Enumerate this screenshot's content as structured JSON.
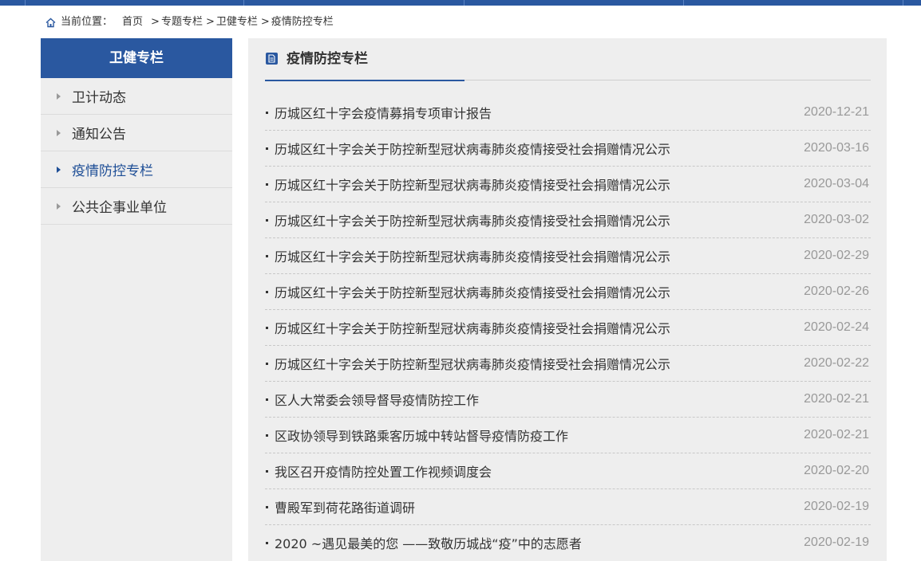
{
  "breadcrumb": {
    "label": "当前位置：",
    "items": [
      "首页",
      "专题专栏",
      "卫健专栏",
      "疫情防控专栏"
    ],
    "separator": ">"
  },
  "sidebar": {
    "title": "卫健专栏",
    "items": [
      {
        "label": "卫计动态",
        "active": false
      },
      {
        "label": "通知公告",
        "active": false
      },
      {
        "label": "疫情防控专栏",
        "active": true
      },
      {
        "label": "公共企事业单位",
        "active": false
      }
    ]
  },
  "main": {
    "title": "疫情防控专栏",
    "icon": "document-icon",
    "news": [
      {
        "title": "历城区红十字会疫情募捐专项审计报告",
        "date": "2020-12-21"
      },
      {
        "title": "历城区红十字会关于防控新型冠状病毒肺炎疫情接受社会捐赠情况公示",
        "date": "2020-03-16"
      },
      {
        "title": "历城区红十字会关于防控新型冠状病毒肺炎疫情接受社会捐赠情况公示",
        "date": "2020-03-04"
      },
      {
        "title": "历城区红十字会关于防控新型冠状病毒肺炎疫情接受社会捐赠情况公示",
        "date": "2020-03-02"
      },
      {
        "title": "历城区红十字会关于防控新型冠状病毒肺炎疫情接受社会捐赠情况公示",
        "date": "2020-02-29"
      },
      {
        "title": "历城区红十字会关于防控新型冠状病毒肺炎疫情接受社会捐赠情况公示",
        "date": "2020-02-26"
      },
      {
        "title": "历城区红十字会关于防控新型冠状病毒肺炎疫情接受社会捐赠情况公示",
        "date": "2020-02-24"
      },
      {
        "title": "历城区红十字会关于防控新型冠状病毒肺炎疫情接受社会捐赠情况公示",
        "date": "2020-02-22"
      },
      {
        "title": "区人大常委会领导督导疫情防控工作",
        "date": "2020-02-21"
      },
      {
        "title": "区政协领导到铁路乘客历城中转站督导疫情防疫工作",
        "date": "2020-02-21"
      },
      {
        "title": "我区召开疫情防控处置工作视频调度会",
        "date": "2020-02-20"
      },
      {
        "title": "曹殿军到荷花路街道调研",
        "date": "2020-02-19"
      },
      {
        "title": "2020 ~遇见最美的您 ——致敬历城战“疫”中的志愿者",
        "date": "2020-02-19"
      }
    ]
  },
  "colors": {
    "brand_blue": "#2a58a0",
    "active_text": "#1e4e96",
    "panel_bg": "#eeeeee",
    "date_gray": "#999999"
  }
}
